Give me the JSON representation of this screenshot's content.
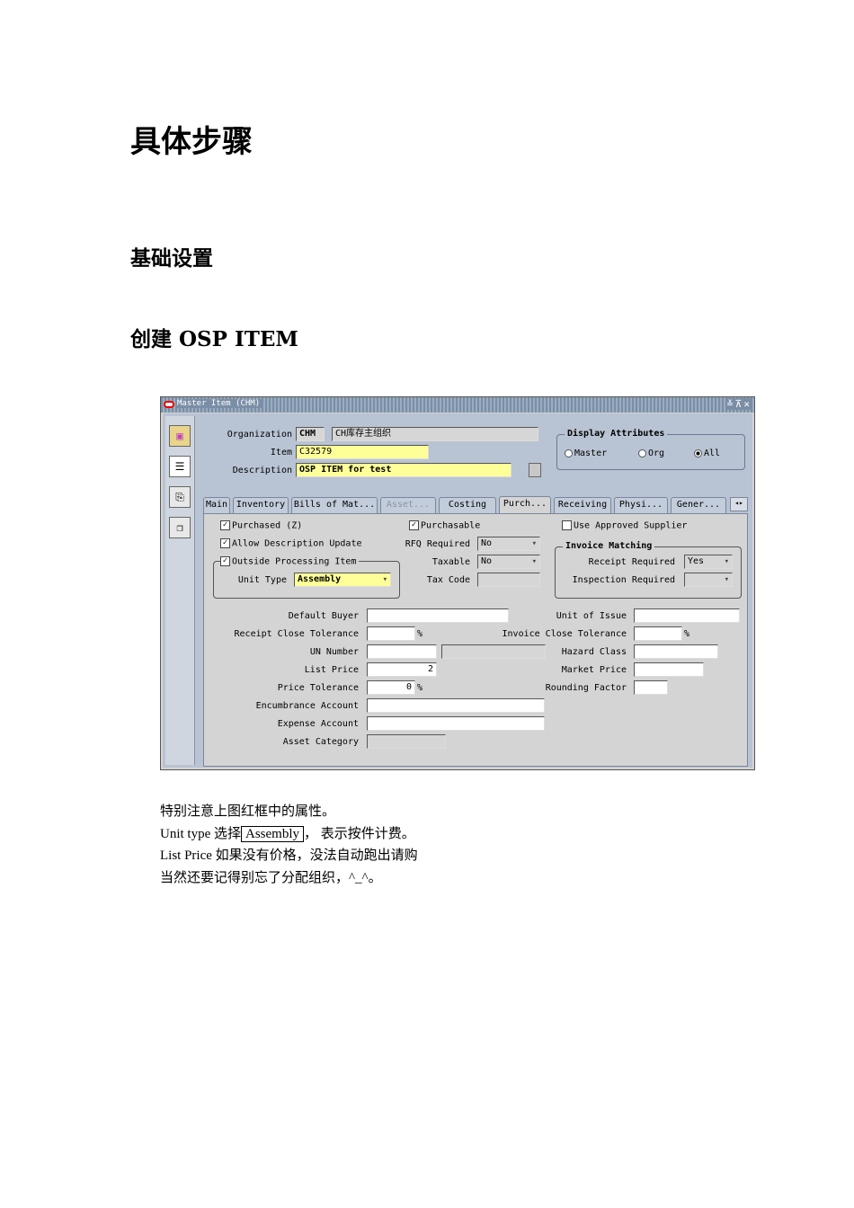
{
  "headings": {
    "h1": "具体步骤",
    "h2": "基础设置",
    "h3": "创建 OSP ITEM"
  },
  "window": {
    "title": "Master Item (CHM)",
    "controls": "≚⊼✕"
  },
  "header": {
    "organization_label": "Organization",
    "organization_code": "CHM",
    "organization_name": "CH库存主组织",
    "item_label": "Item",
    "item_value": "C32579",
    "description_label": "Description",
    "description_value": "OSP ITEM for test"
  },
  "display_attributes": {
    "title": "Display Attributes",
    "options": [
      "Master",
      "Org",
      "All"
    ],
    "selected": "All"
  },
  "tabs": [
    {
      "label": "Main"
    },
    {
      "label": "Inventory"
    },
    {
      "label": "Bills of Mat..."
    },
    {
      "label": "Asset..."
    },
    {
      "label": "Costing"
    },
    {
      "label": "Purch..."
    },
    {
      "label": "Receiving"
    },
    {
      "label": "Physi..."
    },
    {
      "label": "Gener..."
    }
  ],
  "active_tab": "Purch...",
  "purchasing": {
    "purchased_label": "Purchased (Z)",
    "allow_desc_update_label": "Allow Description Update",
    "outside_processing_label": "Outside Processing Item",
    "unit_type_label": "Unit Type",
    "unit_type_value": "Assembly",
    "purchasable_label": "Purchasable",
    "rfq_required_label": "RFQ Required",
    "rfq_required_value": "No",
    "taxable_label": "Taxable",
    "taxable_value": "No",
    "tax_code_label": "Tax Code",
    "use_approved_supplier_label": "Use Approved Supplier",
    "invoice_matching_title": "Invoice Matching",
    "receipt_required_label": "Receipt Required",
    "receipt_required_value": "Yes",
    "inspection_required_label": "Inspection Required",
    "default_buyer_label": "Default Buyer",
    "receipt_close_tol_label": "Receipt Close Tolerance",
    "un_number_label": "UN Number",
    "list_price_label": "List Price",
    "list_price_value": "2",
    "price_tolerance_label": "Price Tolerance",
    "price_tolerance_value": "0",
    "encumbrance_label": "Encumbrance Account",
    "expense_label": "Expense Account",
    "asset_category_label": "Asset Category",
    "unit_of_issue_label": "Unit of Issue",
    "invoice_close_tol_label": "Invoice Close Tolerance",
    "hazard_class_label": "Hazard Class",
    "market_price_label": "Market Price",
    "rounding_factor_label": "Rounding Factor",
    "percent": "%"
  },
  "notes": {
    "line1": "特别注意上图红框中的属性。",
    "line2_prefix": "Unit type 选择",
    "line2_boxed": "Assembly",
    "line2_suffix": "， 表示按件计费。",
    "line3": "List Price 如果没有价格，没法自动跑出请购",
    "line4": "当然还要记得别忘了分配组织，^_^。"
  },
  "colors": {
    "required_field": "#ffff99",
    "window_bg": "#b8c3d3",
    "titlebar": "#7a8ea6"
  }
}
